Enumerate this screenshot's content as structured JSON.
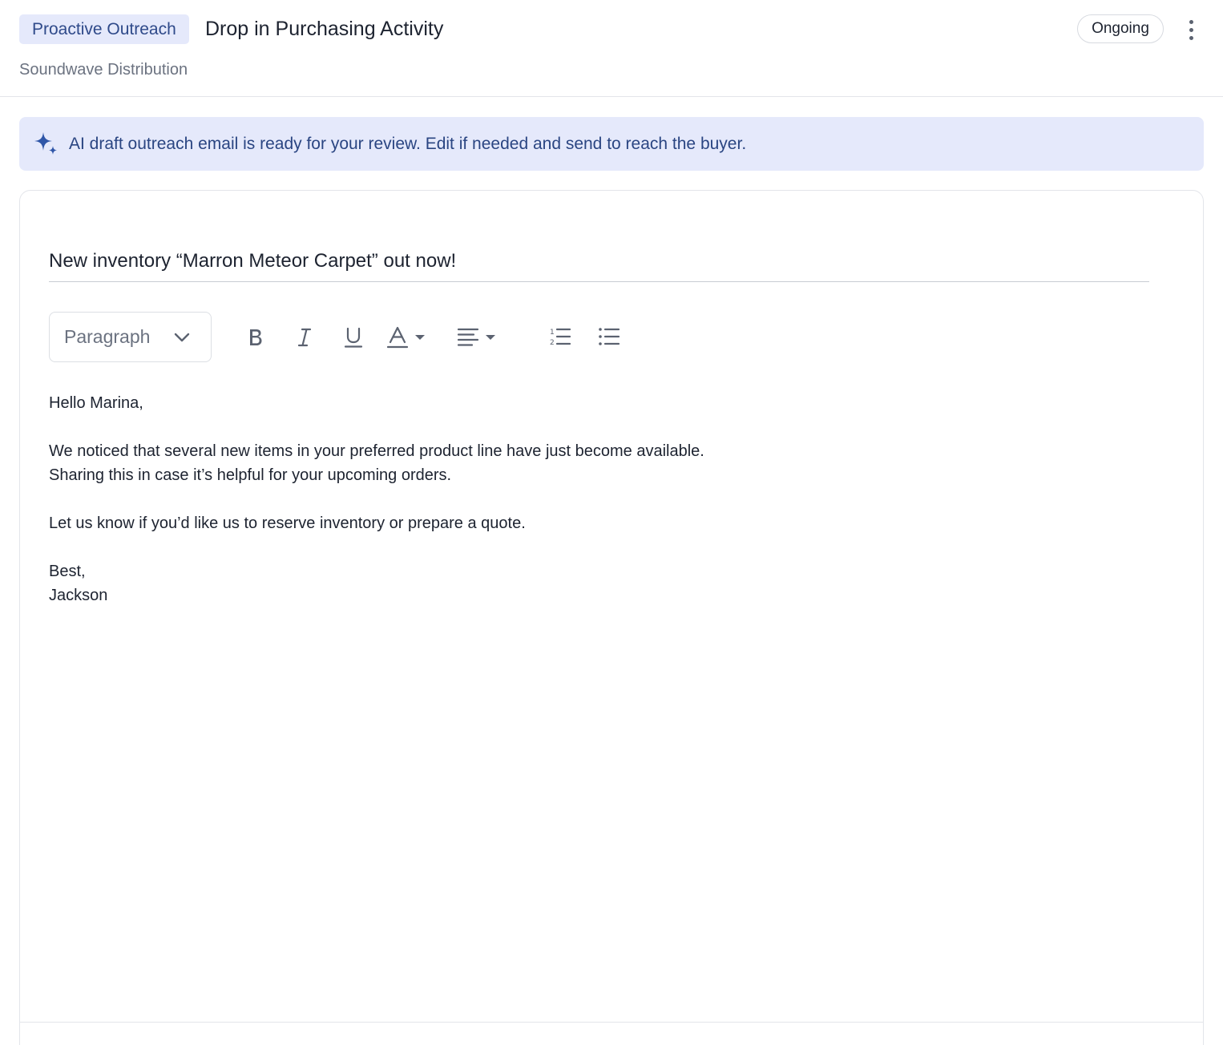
{
  "header": {
    "tag": "Proactive Outreach",
    "title": "Drop in Purchasing Activity",
    "company": "Soundwave Distribution",
    "status": "Ongoing"
  },
  "banner": {
    "message": "AI draft outreach email is ready for your review. Edit if needed and send to reach the buyer."
  },
  "editor": {
    "subject": "New inventory “Marron Meteor Carpet” out now!",
    "toolbar": {
      "block_format": "Paragraph",
      "buttons": [
        "bold",
        "italic",
        "underline",
        "text-color",
        "align",
        "ordered-list",
        "bullet-list"
      ]
    },
    "body": {
      "greeting": "Hello Marina,",
      "line1": "We noticed that several new items in your preferred product line have just become available.",
      "line2": "Sharing this in case it’s helpful for your upcoming orders.",
      "line3": "Let us know if you’d like us to reserve inventory or prepare a quote.",
      "signoff": "Best,",
      "signature": "Jackson"
    }
  },
  "colors": {
    "accent_bg": "#e5e9fb",
    "accent_text": "#2a4582",
    "sparkle": "#2f56a8"
  }
}
